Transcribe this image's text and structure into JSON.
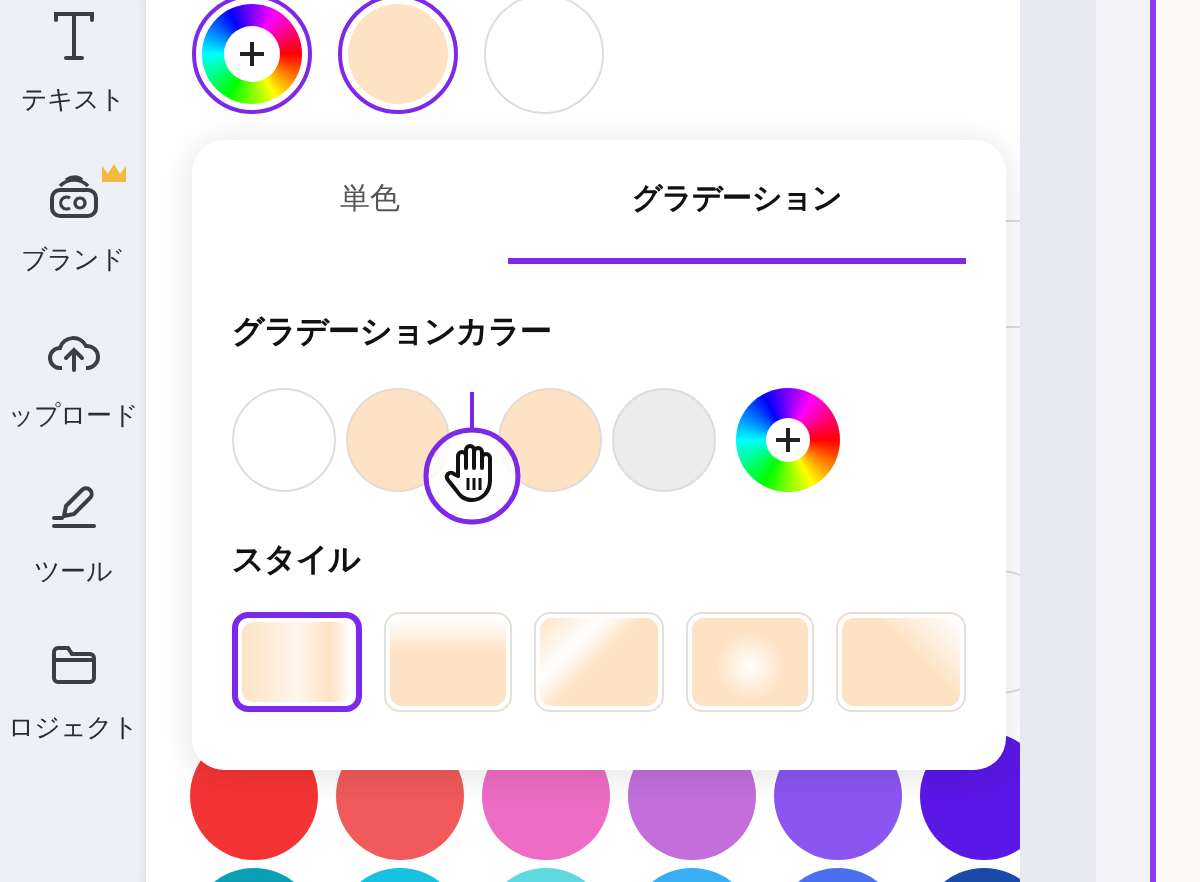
{
  "sidebar": {
    "items": [
      {
        "kind": "text",
        "label": "テキスト",
        "premium": false
      },
      {
        "kind": "brand",
        "label": "ブランド",
        "premium": true
      },
      {
        "kind": "upload",
        "label": "ップロード",
        "premium": false
      },
      {
        "kind": "tools",
        "label": "ツール",
        "premium": false
      },
      {
        "kind": "projects",
        "label": "ロジェクト",
        "premium": false
      }
    ]
  },
  "top_swatches": [
    {
      "kind": "add",
      "selected": true
    },
    {
      "kind": "color",
      "color": "#fde3c4",
      "selected": true
    },
    {
      "kind": "color",
      "color": "#ffffff",
      "selected": false
    }
  ],
  "palette": [
    {
      "color": "#f43434"
    },
    {
      "color": "#f05a5a"
    },
    {
      "color": "#ee6cc4"
    },
    {
      "color": "#c26fdc"
    },
    {
      "color": "#8b55f2"
    },
    {
      "color": "#5b17e6"
    },
    {
      "color": "#0a9fb4"
    },
    {
      "color": "#17c2e0"
    },
    {
      "color": "#5fd8e0"
    },
    {
      "color": "#38aef5"
    },
    {
      "color": "#4a70f0"
    },
    {
      "color": "#1c4aa8"
    }
  ],
  "popup": {
    "tabs": [
      {
        "label": "単色",
        "selected": false
      },
      {
        "label": "グラデーション",
        "selected": true
      }
    ],
    "gradient_colors": {
      "title": "グラデーションカラー",
      "stops": [
        {
          "kind": "color",
          "color": "#ffffff"
        },
        {
          "kind": "color",
          "color": "#fde3c4"
        },
        {
          "kind": "color",
          "color": "#fde3c4"
        },
        {
          "kind": "color",
          "color": "#ececec"
        },
        {
          "kind": "add"
        }
      ]
    },
    "style": {
      "title": "スタイル",
      "options": [
        {
          "kind": "horizontal",
          "selected": true
        },
        {
          "kind": "vertical",
          "selected": false
        },
        {
          "kind": "diagonal",
          "selected": false
        },
        {
          "kind": "radial",
          "selected": false
        },
        {
          "kind": "corner",
          "selected": false
        }
      ]
    }
  }
}
